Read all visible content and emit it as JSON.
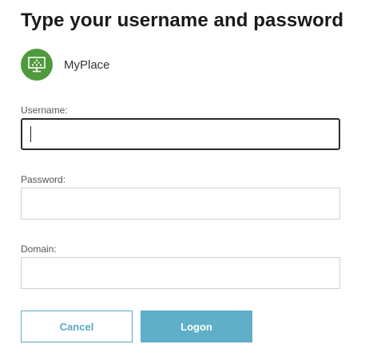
{
  "dialog": {
    "title": "Type your username and password"
  },
  "app": {
    "name": "MyPlace",
    "icon": "desktop-icon",
    "icon_color": "#4f9a3d"
  },
  "form": {
    "username": {
      "label": "Username:",
      "value": ""
    },
    "password": {
      "label": "Password:",
      "value": ""
    },
    "domain": {
      "label": "Domain:",
      "value": ""
    }
  },
  "buttons": {
    "cancel_label": "Cancel",
    "logon_label": "Logon"
  },
  "colors": {
    "accent": "#5fafc9",
    "title_text": "#1a1a1a"
  }
}
